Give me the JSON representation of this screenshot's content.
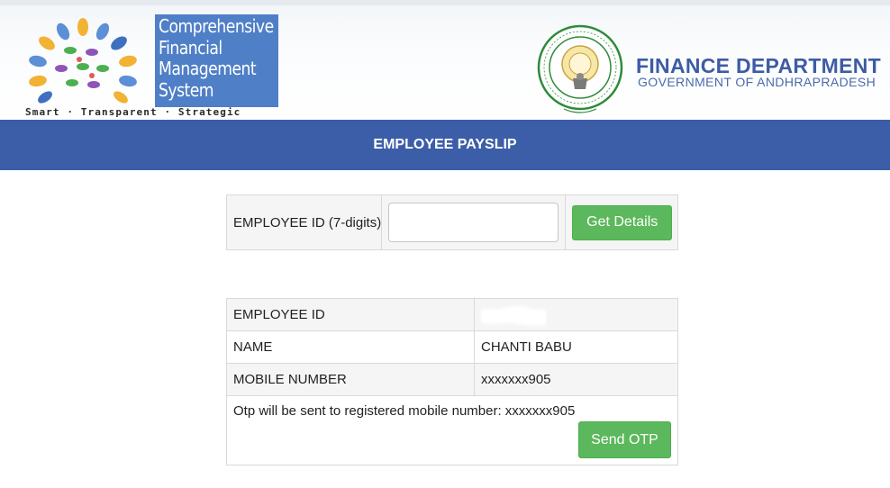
{
  "header": {
    "logo_lines": [
      "Comprehensive",
      "Financial",
      "Management",
      "System"
    ],
    "tagline": "Smart · Transparent · Strategic",
    "seal_name": "andhra-pradesh-state-emblem",
    "dept_title": "FINANCE DEPARTMENT",
    "dept_subtitle": "GOVERNMENT OF  ANDHRAPRADESH"
  },
  "banner": {
    "title": "EMPLOYEE PAYSLIP"
  },
  "search": {
    "label": "EMPLOYEE ID (7-digits)",
    "input_value": "",
    "button": "Get Details"
  },
  "details": {
    "rows": [
      {
        "label": "EMPLOYEE ID",
        "value": ""
      },
      {
        "label": "NAME",
        "value": "CHANTI BABU"
      },
      {
        "label": "MOBILE NUMBER",
        "value": "xxxxxxx905"
      }
    ],
    "otp_note": "Otp will be sent to registered mobile number: xxxxxxx905",
    "otp_button": "Send OTP"
  },
  "colors": {
    "banner": "#3c5ea8",
    "logo_box": "#4f7fc7",
    "dept_title": "#3d5ca5",
    "button_green": "#5cb85c",
    "seal_green": "#2e8b3a"
  }
}
